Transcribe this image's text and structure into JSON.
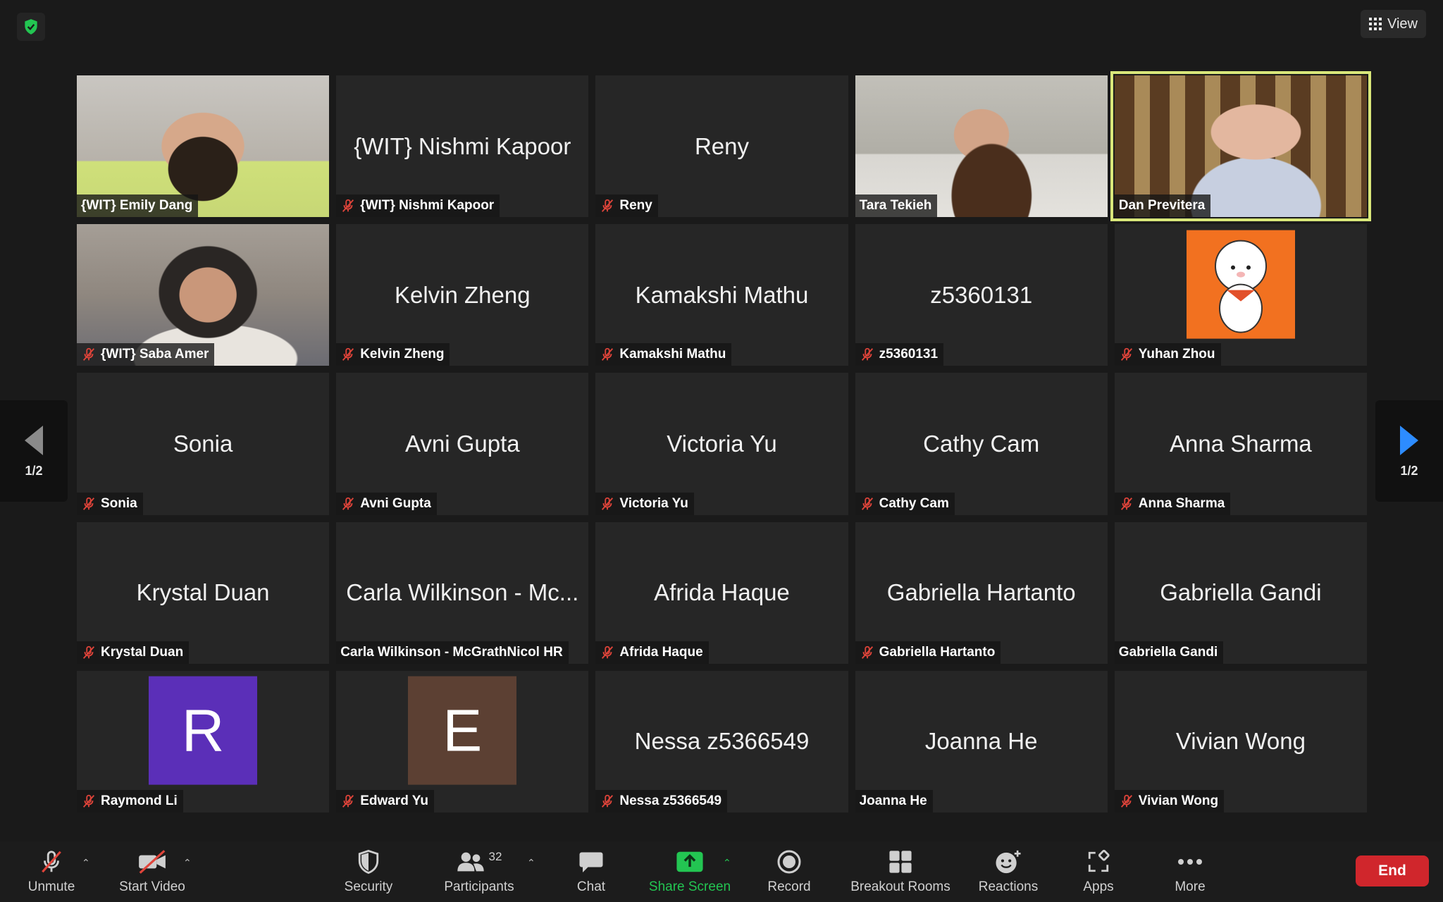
{
  "header": {
    "view_label": "View"
  },
  "nav": {
    "prev_page": "1/2",
    "next_page": "1/2"
  },
  "tiles": [
    {
      "name": "{WIT} Emily Dang",
      "label": "{WIT} Emily Dang",
      "muted": false
    },
    {
      "name": "{WIT} Nishmi Kapoor",
      "label": "{WIT} Nishmi Kapoor",
      "muted": true
    },
    {
      "name": "Reny",
      "label": "Reny",
      "muted": true
    },
    {
      "name": "Tara Tekieh",
      "label": "Tara Tekieh",
      "muted": false
    },
    {
      "name": "Dan Previtera",
      "label": "Dan Previtera",
      "muted": false
    },
    {
      "name": "{WIT} Saba Amer",
      "label": "{WIT} Saba Amer",
      "muted": true
    },
    {
      "name": "Kelvin Zheng",
      "label": "Kelvin Zheng",
      "muted": true
    },
    {
      "name": "Kamakshi Mathu",
      "label": "Kamakshi Mathu",
      "muted": true
    },
    {
      "name": "z5360131",
      "label": "z5360131",
      "muted": true
    },
    {
      "name": "Yuhan Zhou",
      "label": "Yuhan Zhou",
      "muted": true
    },
    {
      "name": "Sonia",
      "label": "Sonia",
      "muted": true
    },
    {
      "name": "Avni Gupta",
      "label": "Avni Gupta",
      "muted": true
    },
    {
      "name": "Victoria Yu",
      "label": "Victoria Yu",
      "muted": true
    },
    {
      "name": "Cathy Cam",
      "label": "Cathy Cam",
      "muted": true
    },
    {
      "name": "Anna Sharma",
      "label": "Anna Sharma",
      "muted": true
    },
    {
      "name": "Krystal Duan",
      "label": "Krystal Duan",
      "muted": true
    },
    {
      "name": "Carla Wilkinson - Mc...",
      "label": "Carla Wilkinson - McGrathNicol HR",
      "muted": false
    },
    {
      "name": "Afrida Haque",
      "label": "Afrida Haque",
      "muted": true
    },
    {
      "name": "Gabriella Hartanto",
      "label": "Gabriella Hartanto",
      "muted": true
    },
    {
      "name": "Gabriella Gandi",
      "label": "Gabriella Gandi",
      "muted": false
    },
    {
      "name": "R",
      "label": "Raymond Li",
      "muted": true
    },
    {
      "name": "E",
      "label": "Edward Yu",
      "muted": true
    },
    {
      "name": "Nessa z5366549",
      "label": "Nessa z5366549",
      "muted": true
    },
    {
      "name": "Joanna He",
      "label": "Joanna He",
      "muted": false
    },
    {
      "name": "Vivian Wong",
      "label": "Vivian Wong",
      "muted": true
    }
  ],
  "toolbar": {
    "unmute": "Unmute",
    "start_video": "Start Video",
    "security": "Security",
    "participants": "Participants",
    "participants_count": "32",
    "chat": "Chat",
    "share_screen": "Share Screen",
    "record": "Record",
    "breakout_rooms": "Breakout Rooms",
    "reactions": "Reactions",
    "apps": "Apps",
    "more": "More",
    "end": "End"
  },
  "colors": {
    "active_speaker_border": "#d9e77a",
    "share_green": "#23c552",
    "end_red": "#d0262c",
    "mute_red": "#e0443a",
    "avatar_r": "#5b2fb8",
    "avatar_e": "#5c4033",
    "avatar_yuhan": "#f27120",
    "nav_arrow_active": "#2d8cff"
  }
}
